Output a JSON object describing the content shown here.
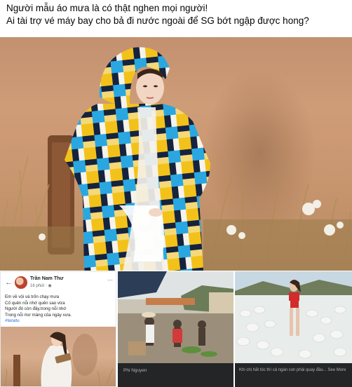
{
  "post": {
    "caption_line1": "Người mẫu áo mưa là có thật nghen mọi người!",
    "caption_line2": "Ai tài trợ vé máy bay cho bả đi nước ngoài để SG bớt ngập được hong?"
  },
  "colors": {
    "raincoat_yellow": "#f3c21a",
    "raincoat_blue": "#2aa7e0",
    "raincoat_navy": "#15233f",
    "backdrop": "#c9976f",
    "hashtag": "#216fdb"
  },
  "embedded_post": {
    "back_icon": "arrow-left-icon",
    "author_name": "Trần Nam Thư",
    "timestamp": "16 phút · ",
    "menu_icon": "more-icon",
    "lines": [
      "Em về vội và trốn chạy mưa",
      "Cố quên nỗi nhớ quên sao vừa",
      "Người đó còn đây,trong nỗi nhớ",
      "Trong nỗi mơ màng của ngày xưa."
    ],
    "hashtag": "#tanatu"
  },
  "tiles": {
    "market_caption": "Phi Nguyen",
    "duck_caption": "Khi chị hất tóc thì cả ngàn con phải quay đầu... See More"
  }
}
